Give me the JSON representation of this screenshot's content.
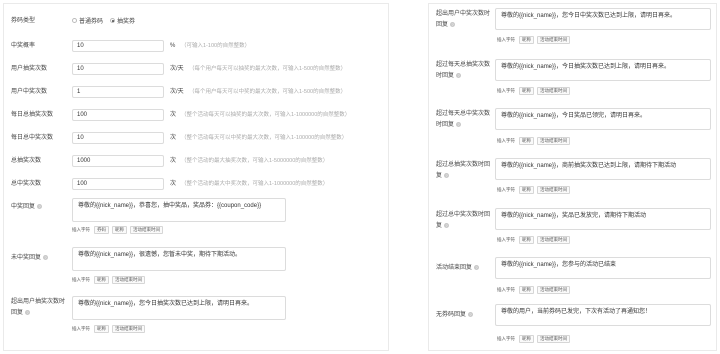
{
  "left": {
    "coupon_type": {
      "label": "券码类型",
      "options": [
        {
          "label": "普通券码",
          "selected": false
        },
        {
          "label": "抽奖券",
          "selected": true
        }
      ]
    },
    "fields": [
      {
        "label": "中奖概率",
        "value": "10",
        "unit": "%",
        "hint": "（可输入1-100的自然整数）"
      },
      {
        "label": "用户抽奖次数",
        "value": "10",
        "unit": "次/天",
        "hint": "（每个用户每天可以抽奖的最大次数，可输入1-500的自然整数）"
      },
      {
        "label": "用户中奖次数",
        "value": "1",
        "unit": "次/天",
        "hint": "（每个用户每天可以中奖的最大次数，可输入1-500的自然整数）"
      },
      {
        "label": "每日总抽奖次数",
        "value": "100",
        "unit": "次",
        "hint": "（整个活动每天可以抽奖的最大次数，可输入1-1000000的自然整数）"
      },
      {
        "label": "每日总中奖次数",
        "value": "10",
        "unit": "次",
        "hint": "（整个活动每天可以中奖的最大次数，可输入1-100000的自然整数）"
      },
      {
        "label": "总抽奖次数",
        "value": "1000",
        "unit": "次",
        "hint": "（整个活动的最大抽奖次数，可输入1-5000000的自然整数）"
      },
      {
        "label": "总中奖次数",
        "value": "100",
        "unit": "次",
        "hint": "（整个活动的最大中奖次数，可输入1-1000000的自然整数）"
      }
    ],
    "replies": [
      {
        "label": "中奖回复",
        "text": "尊敬的{{nick_name}}，恭喜您，抽中奖品，奖品券：{{coupon_code}}",
        "tags": [
          "插入字符",
          "券码",
          "昵称",
          "活动结束时间"
        ]
      },
      {
        "label": "未中奖回复",
        "text": "尊敬的{{nick_name}}，很遗憾，您暂未中奖，期待下期活动。",
        "tags": [
          "插入字符",
          "昵称",
          "活动结束时间"
        ]
      },
      {
        "label": "超出用户抽奖次数时回复",
        "text": "尊敬的{{nick_name}}，您今日抽奖次数已达到上限，请明日再来。",
        "tags": [
          "插入字符",
          "昵称",
          "活动结束时间"
        ]
      }
    ]
  },
  "right": {
    "replies": [
      {
        "label": "超出用户中奖次数时回复",
        "text": "尊敬的{{nick_name}}，您今日中奖次数已达到上限，请明日再来。",
        "tags": [
          "插入字符",
          "昵称",
          "活动结束时间"
        ]
      },
      {
        "label": "超过每天总抽奖次数时回复",
        "text": "尊敬的{{nick_name}}，今日抽奖次数已达到上限，请明日再来。",
        "tags": [
          "插入字符",
          "昵称",
          "活动结束时间"
        ]
      },
      {
        "label": "超过每天总中奖次数时回复",
        "text": "尊敬的{{nick_name}}，今日奖品已领完，请明日再来。",
        "tags": [
          "插入字符",
          "昵称",
          "活动结束时间"
        ]
      },
      {
        "label": "超过总抽奖次数时回复",
        "text": "尊敬的{{nick_name}}，商前抽奖次数已达到上限，请期待下期活动",
        "tags": [
          "插入字符",
          "昵称",
          "活动结束时间"
        ]
      },
      {
        "label": "超过总中奖次数时回复",
        "text": "尊敬的{{nick_name}}，奖品已发放完，请期待下期活动",
        "tags": [
          "插入字符",
          "昵称",
          "活动结束时间"
        ]
      },
      {
        "label": "活动结束回复",
        "text": "尊敬的{{nick_name}}，您参与的活动已结束",
        "tags": [
          "插入字符",
          "昵称",
          "活动结束时间"
        ]
      },
      {
        "label": "无券码回复",
        "text": "尊敬的用户，当前券码已发完，下次有活动了再通知您！",
        "tags": [
          "插入字符",
          "昵称",
          "活动结束时间"
        ]
      }
    ]
  }
}
